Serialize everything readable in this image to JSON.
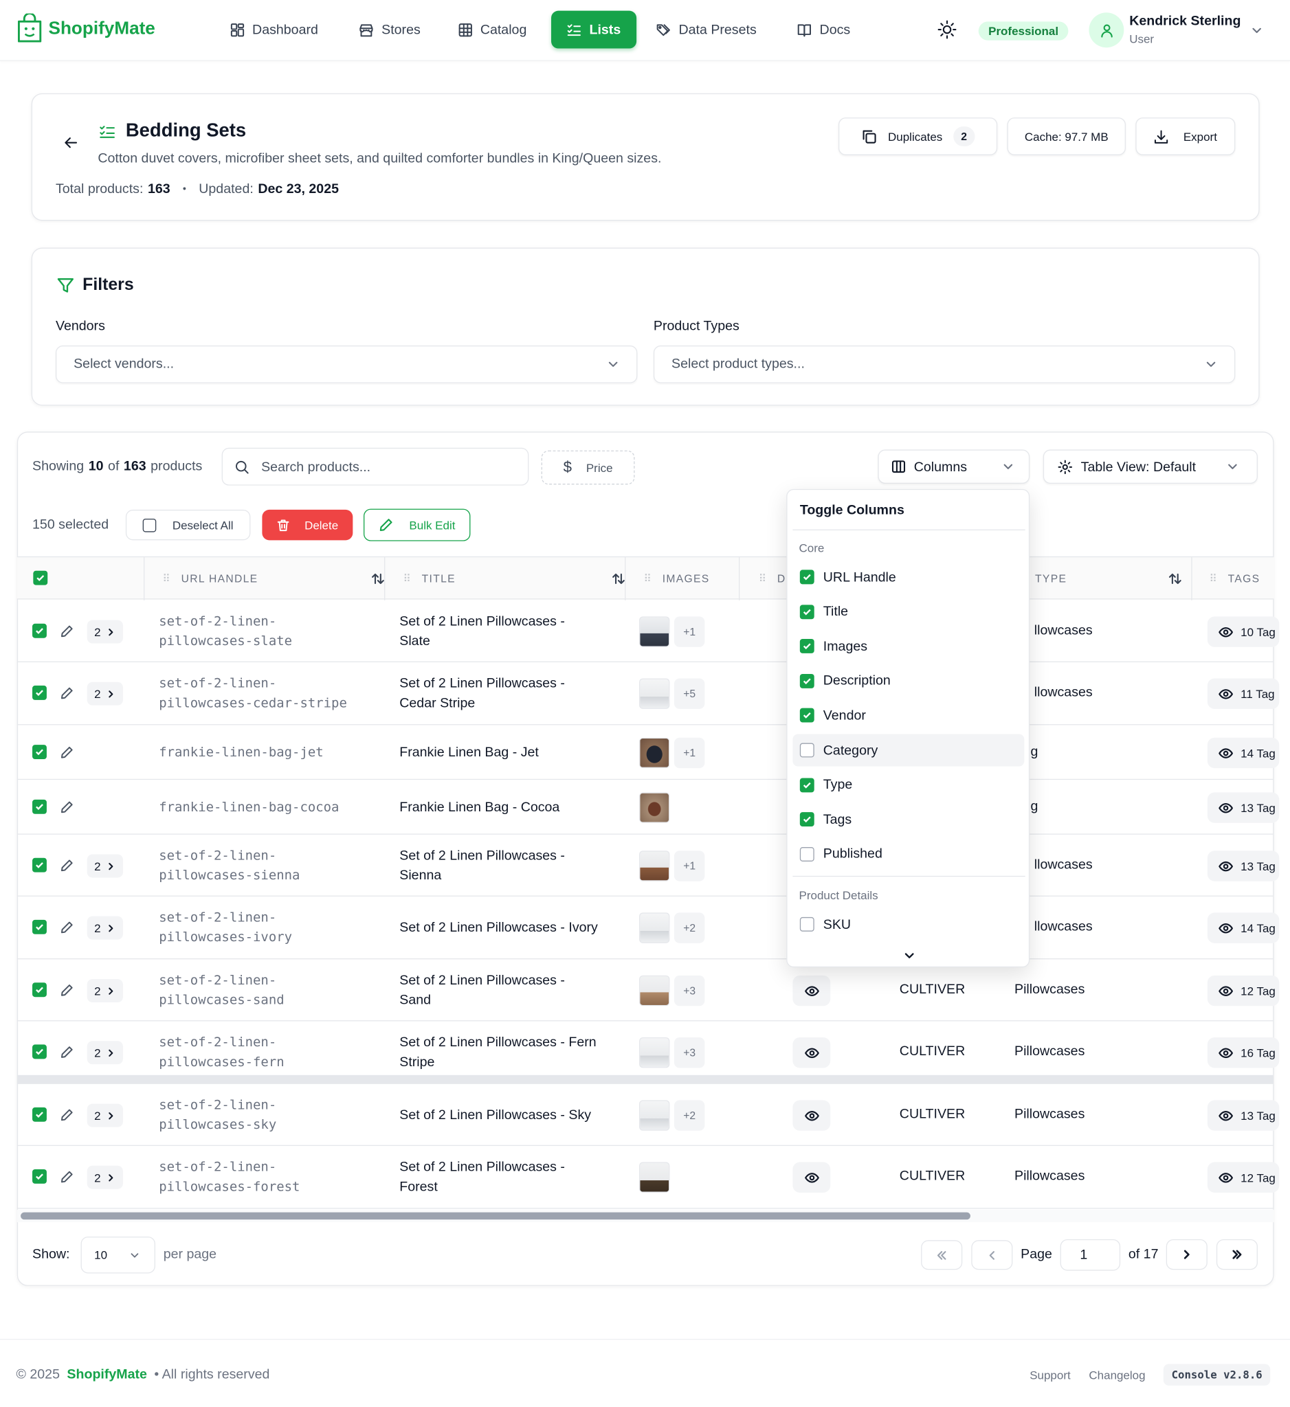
{
  "brand": {
    "name": "ShopifyMate",
    "accent": "#16a34a"
  },
  "nav": {
    "items": [
      {
        "label": "Dashboard",
        "icon": "dashboard-icon"
      },
      {
        "label": "Stores",
        "icon": "store-icon"
      },
      {
        "label": "Catalog",
        "icon": "table-icon"
      },
      {
        "label": "Lists",
        "icon": "list-check-icon",
        "active": true
      },
      {
        "label": "Data Presets",
        "icon": "tags-icon"
      },
      {
        "label": "Docs",
        "icon": "book-icon"
      }
    ]
  },
  "header": {
    "plan_badge": "Professional",
    "user_name": "Kendrick Sterling",
    "user_role": "User"
  },
  "list": {
    "title": "Bedding Sets",
    "description": "Cotton duvet covers, microfiber sheet sets, and quilted comforter bundles in King/Queen sizes.",
    "total_label": "Total products:",
    "total_value": "163",
    "updated_label": "Updated:",
    "updated_value": "Dec 23, 2025",
    "duplicates_label": "Duplicates",
    "duplicates_count": "2",
    "cache_label": "Cache: 97.7 MB",
    "export_label": "Export"
  },
  "filters": {
    "title": "Filters",
    "vendors_label": "Vendors",
    "vendors_placeholder": "Select vendors...",
    "types_label": "Product Types",
    "types_placeholder": "Select product types..."
  },
  "table": {
    "showing_prefix": "Showing",
    "showing_count": "10",
    "showing_of": "of",
    "showing_total": "163",
    "showing_suffix": "products",
    "search_placeholder": "Search products...",
    "price_label": "Price",
    "columns_label": "Columns",
    "view_label": "Table View: Default",
    "selected_label": "150 selected",
    "deselect_label": "Deselect All",
    "delete_label": "Delete",
    "bulk_edit_label": "Bulk Edit",
    "headers": {
      "handle": "URL HANDLE",
      "title": "TITLE",
      "images": "IMAGES",
      "desc": "D",
      "type": "TYPE",
      "tags": "TAGS"
    },
    "rows": [
      {
        "variants": "2",
        "handle": [
          "set-of-2-linen-",
          "pillowcases-slate"
        ],
        "title": [
          "Set of 2 Linen Pillowcases -",
          "Slate"
        ],
        "thumb": "slate",
        "extra": "+1",
        "vendor": "",
        "type": "llowcases",
        "tags": "10 Tag"
      },
      {
        "variants": "2",
        "handle": [
          "set-of-2-linen-",
          "pillowcases-cedar-stripe"
        ],
        "title": [
          "Set of 2 Linen Pillowcases -",
          "Cedar Stripe"
        ],
        "thumb": "white",
        "extra": "+5",
        "vendor": "",
        "type": "llowcases",
        "tags": "11 Tag"
      },
      {
        "variants": "",
        "handle": [
          "frankie-linen-bag-jet"
        ],
        "title": [
          "Frankie Linen Bag - Jet"
        ],
        "thumb": "bagjet",
        "extra": "+1",
        "vendor": "",
        "type": "g",
        "tags": "14 Tag"
      },
      {
        "variants": "",
        "handle": [
          "frankie-linen-bag-cocoa"
        ],
        "title": [
          "Frankie Linen Bag - Cocoa"
        ],
        "thumb": "bagcocoa",
        "extra": "",
        "vendor": "",
        "type": "g",
        "tags": "13 Tag"
      },
      {
        "variants": "2",
        "handle": [
          "set-of-2-linen-",
          "pillowcases-sienna"
        ],
        "title": [
          "Set of 2 Linen Pillowcases -",
          "Sienna"
        ],
        "thumb": "sienna",
        "extra": "+1",
        "vendor": "",
        "type": "llowcases",
        "tags": "13 Tag"
      },
      {
        "variants": "2",
        "handle": [
          "set-of-2-linen-",
          "pillowcases-ivory"
        ],
        "title": [
          "Set of 2 Linen Pillowcases - Ivory"
        ],
        "thumb": "white",
        "extra": "+2",
        "vendor": "",
        "type": "llowcases",
        "tags": "14 Tag"
      },
      {
        "variants": "2",
        "handle": [
          "set-of-2-linen-",
          "pillowcases-sand"
        ],
        "title": [
          "Set of 2 Linen Pillowcases -",
          "Sand"
        ],
        "thumb": "sand",
        "extra": "+3",
        "vendor": "CULTIVER",
        "type": "Pillowcases",
        "tags": "12 Tag"
      },
      {
        "variants": "2",
        "handle": [
          "set-of-2-linen-",
          "pillowcases-fern"
        ],
        "title": [
          "Set of 2 Linen Pillowcases - Fern",
          "Stripe"
        ],
        "thumb": "white",
        "extra": "+3",
        "vendor": "CULTIVER",
        "type": "Pillowcases",
        "tags": "16 Tag"
      },
      {
        "variants": "2",
        "handle": [
          "set-of-2-linen-",
          "pillowcases-sky"
        ],
        "title": [
          "Set of 2 Linen Pillowcases - Sky"
        ],
        "thumb": "white",
        "extra": "+2",
        "vendor": "CULTIVER",
        "type": "Pillowcases",
        "tags": "13 Tag"
      },
      {
        "variants": "2",
        "handle": [
          "set-of-2-linen-",
          "pillowcases-forest"
        ],
        "title": [
          "Set of 2 Linen Pillowcases -",
          "Forest"
        ],
        "thumb": "forest",
        "extra": "",
        "vendor": "CULTIVER",
        "type": "Pillowcases",
        "tags": "12 Tag"
      }
    ]
  },
  "columns_menu": {
    "title": "Toggle Columns",
    "core_label": "Core",
    "core": [
      {
        "label": "URL Handle",
        "checked": true
      },
      {
        "label": "Title",
        "checked": true
      },
      {
        "label": "Images",
        "checked": true
      },
      {
        "label": "Description",
        "checked": true
      },
      {
        "label": "Vendor",
        "checked": true
      },
      {
        "label": "Category",
        "checked": false
      },
      {
        "label": "Type",
        "checked": true
      },
      {
        "label": "Tags",
        "checked": true
      },
      {
        "label": "Published",
        "checked": false
      }
    ],
    "details_label": "Product Details",
    "details": [
      {
        "label": "SKU",
        "checked": false
      }
    ]
  },
  "pagination": {
    "show_label": "Show:",
    "per_page_value": "10",
    "per_page_label": "per page",
    "page_label": "Page",
    "page_value": "1",
    "of_label": "of 17"
  },
  "footer": {
    "copyright": "© 2025",
    "brand": "ShopifyMate",
    "rights": "• All rights reserved",
    "support": "Support",
    "changelog": "Changelog",
    "console": "Console v2.8.6"
  }
}
